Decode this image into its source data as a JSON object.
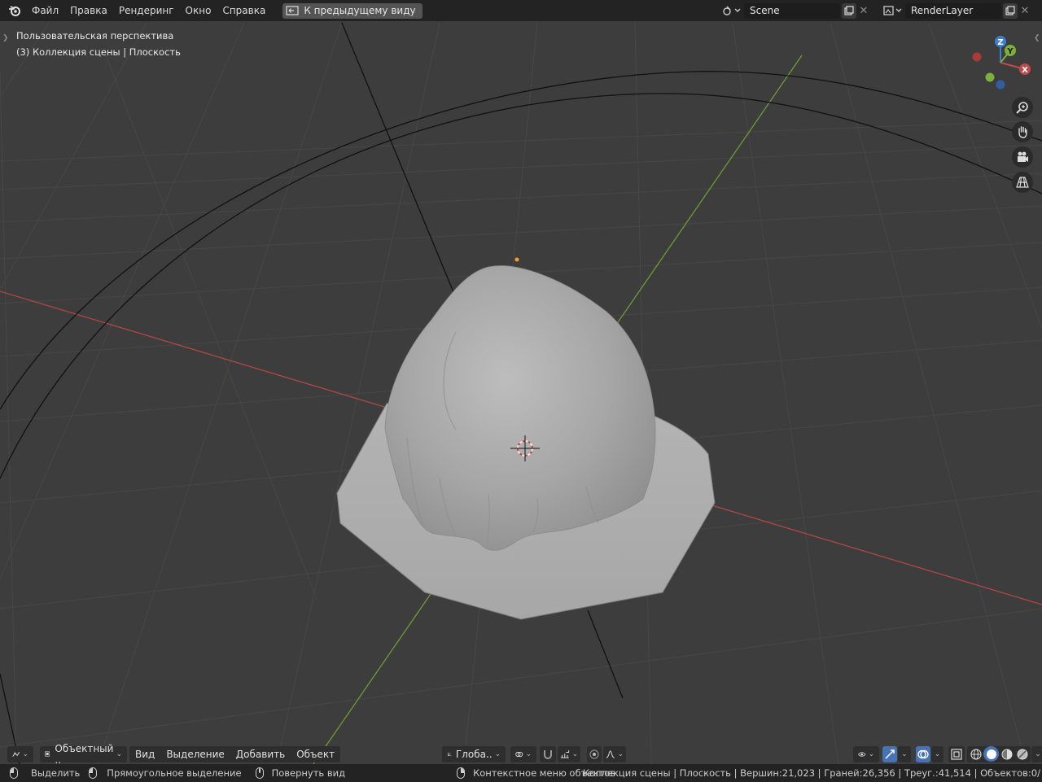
{
  "topbar": {
    "menus": [
      "Файл",
      "Правка",
      "Рендеринг",
      "Окно",
      "Справка"
    ],
    "back_button": "К предыдущему виду",
    "scene": "Scene",
    "view_layer": "RenderLayer"
  },
  "viewport": {
    "perspective_label": "Пользовательская перспектива",
    "collection_label": "(3) Коллекция сцены | Плоскость",
    "gizmo_axes": {
      "x": "X",
      "y": "Y",
      "z": "Z"
    },
    "colors": {
      "x_axis": "#c44a4a",
      "y_axis": "#7bb03a",
      "z_axis": "#3a7fd0",
      "grid": "#4a4a4a",
      "mesh": "#a9a9a9"
    }
  },
  "header3d": {
    "mode": "Объектный ..",
    "menus": [
      "Вид",
      "Выделение",
      "Добавить",
      "Объект"
    ],
    "transform_orientation": "Глоба.."
  },
  "statusbar": {
    "select": "Выделить",
    "box_select": "Прямоугольное выделение",
    "rotate_view": "Повернуть вид",
    "context_menu": "Контекстное меню объектов",
    "stats": "Коллекция сцены | Плоскость | Вершин:21,023 | Граней:26,356 | Треуг.:41,514 | Объектов:0/"
  }
}
